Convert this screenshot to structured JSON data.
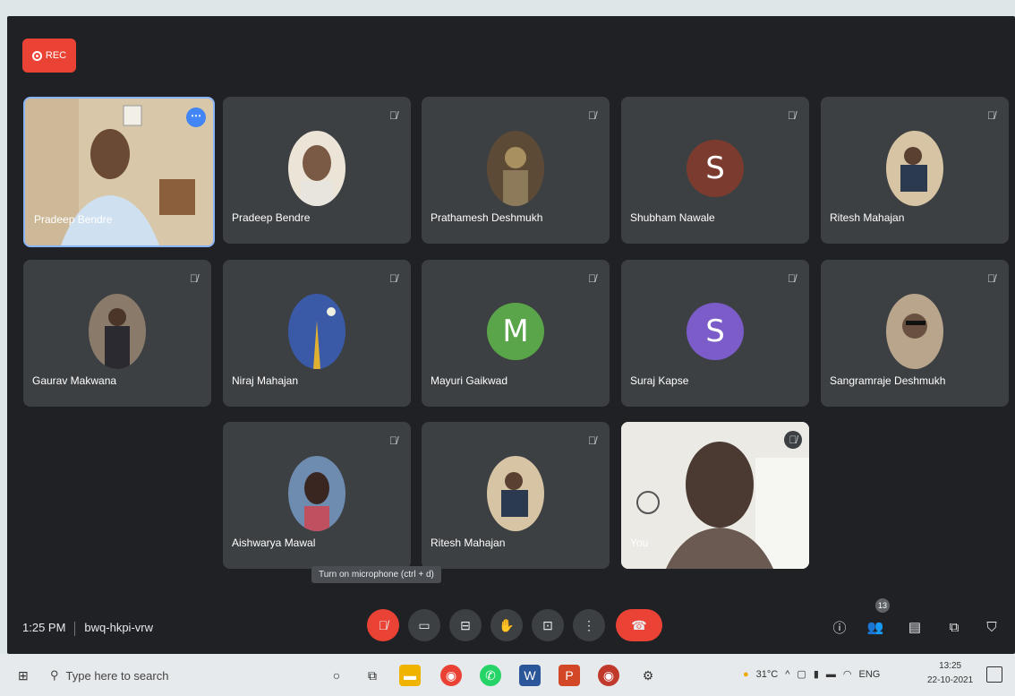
{
  "meeting": {
    "rec_label": "REC",
    "time": "1:25 PM",
    "code": "bwq-hkpi-vrw",
    "tooltip": "Turn on microphone (ctrl + d)",
    "participant_count": "13"
  },
  "participants": [
    {
      "name": "Pradeep Bendre",
      "type": "video"
    },
    {
      "name": "Pradeep Bendre",
      "type": "photo",
      "color": "#e8e2d8"
    },
    {
      "name": "Prathamesh Deshmukh",
      "type": "photo",
      "color": "#6b5a45"
    },
    {
      "name": "Shubham Nawale",
      "type": "letter",
      "letter": "S",
      "color": "#7b3b2e"
    },
    {
      "name": "Ritesh Mahajan",
      "type": "photo",
      "color": "#c7b59a"
    },
    {
      "name": "Gaurav Makwana",
      "type": "photo",
      "color": "#8a7a6a"
    },
    {
      "name": "Niraj Mahajan",
      "type": "photo",
      "color": "#3a5aa8"
    },
    {
      "name": "Mayuri Gaikwad",
      "type": "letter",
      "letter": "M",
      "color": "#5aa54a"
    },
    {
      "name": "Suraj Kapse",
      "type": "letter",
      "letter": "S",
      "color": "#7b5cc9"
    },
    {
      "name": "Sangramraje Deshmukh",
      "type": "photo",
      "color": "#b9a58c"
    },
    {
      "name": "Aishwarya Mawal",
      "type": "photo",
      "color": "#6e8bb0"
    },
    {
      "name": "Ritesh Mahajan",
      "type": "photo",
      "color": "#c7b59a"
    },
    {
      "name": "You",
      "type": "video"
    }
  ],
  "taskbar": {
    "search_placeholder": "Type here to search",
    "temperature": "31°C",
    "language": "ENG",
    "clock_time": "13:25",
    "clock_date": "22-10-2021"
  },
  "colors": {
    "meet_bg": "#202124",
    "tile_bg": "#3c4043",
    "accent_red": "#ea4335",
    "accent_blue": "#8ab4f8"
  }
}
